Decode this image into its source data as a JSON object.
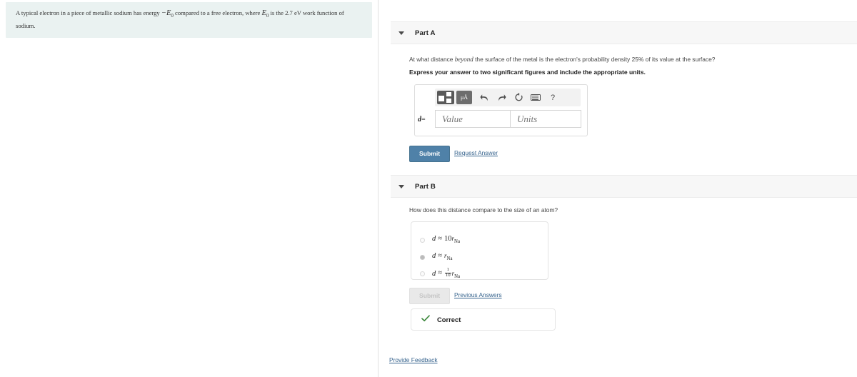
{
  "problem": {
    "text_before": "A typical electron in a piece of metallic sodium has energy ",
    "energy_symbol": "−E",
    "energy_sub": "0",
    "text_middle": " compared to a free electron, where ",
    "symbol2": "E",
    "symbol2_sub": "0",
    "text_after": " is the 2.7 eV work function of sodium."
  },
  "partA": {
    "title": "Part A",
    "question_pre": "At what distance ",
    "question_em": "beyond",
    "question_post": " the surface of the metal is the electron's probability density 25% of its value at the surface?",
    "instruction": "Express your answer to two significant figures and include the appropriate units.",
    "toolbar": {
      "template_icon": "template-icon",
      "units_icon": "μÅ",
      "undo_icon": "undo-arrow-icon",
      "redo_icon": "redo-arrow-icon",
      "reset_icon": "reset-circle-icon",
      "keyboard_icon": "keyboard-icon",
      "help_icon": "?"
    },
    "variable_label": "d",
    "equals": "=",
    "value_placeholder": "Value",
    "units_placeholder": "Units",
    "value_current": "",
    "units_current": "",
    "submit_label": "Submit",
    "request_answer_label": "Request Answer"
  },
  "partB": {
    "title": "Part B",
    "question": "How does this distance compare to the size of an atom?",
    "options": [
      {
        "id": "opt-1",
        "var": "d",
        "rel": "≈",
        "coef": "10",
        "r": "r",
        "rsub": "Na",
        "frac": null,
        "selected": false
      },
      {
        "id": "opt-2",
        "var": "d",
        "rel": "≈",
        "coef": "",
        "r": "r",
        "rsub": "Na",
        "frac": null,
        "selected": true
      },
      {
        "id": "opt-3",
        "var": "d",
        "rel": "≈",
        "coef": "",
        "r": "r",
        "rsub": "Na",
        "frac": {
          "num": "1",
          "den": "10"
        },
        "selected": false
      }
    ],
    "submit_label": "Submit",
    "submit_disabled": true,
    "previous_answers_label": "Previous Answers",
    "feedback": {
      "icon": "check-icon",
      "label": "Correct",
      "color": "#3f8a3f"
    }
  },
  "footer": {
    "provide_feedback_label": "Provide Feedback"
  },
  "colors": {
    "accent_button": "#4f81a8",
    "link": "#36638d",
    "problem_bg": "#eaf2f1",
    "header_bg": "#f7f7f7",
    "correct_green": "#3f8a3f"
  }
}
